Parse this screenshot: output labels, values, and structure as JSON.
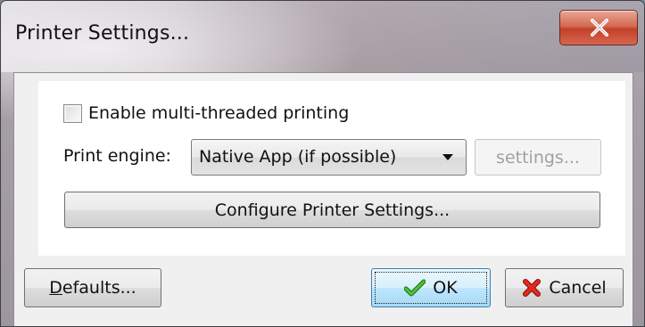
{
  "window": {
    "title": "Printer Settings..."
  },
  "options": {
    "multithread_label": "Enable multi-threaded printing",
    "multithread_checked": false,
    "engine_label": "Print engine:",
    "engine_selected": "Native App (if possible)",
    "engine_settings_label": "settings...",
    "configure_label": "Configure Printer Settings..."
  },
  "footer": {
    "defaults_mnemonic": "D",
    "defaults_rest": "efaults...",
    "ok_label": "OK",
    "cancel_label": "Cancel"
  },
  "icons": {
    "close": "close-x-icon",
    "ok": "green-checkmark-icon",
    "cancel": "red-x-icon"
  },
  "colors": {
    "close_button": "#c2412a",
    "ok_check": "#2f9a1f",
    "cancel_x": "#d0201a"
  }
}
